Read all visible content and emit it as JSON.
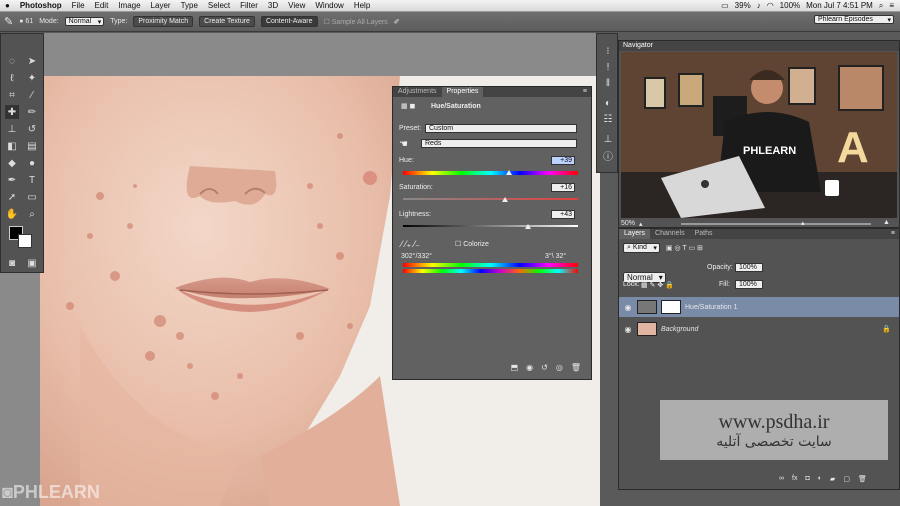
{
  "menubar": {
    "apple": "",
    "app": "Photoshop",
    "items": [
      "File",
      "Edit",
      "Image",
      "Layer",
      "Type",
      "Select",
      "Filter",
      "3D",
      "View",
      "Window",
      "Help"
    ],
    "battery": "39%",
    "battery2": "100%",
    "clock": "Mon Jul 7  4:51 PM"
  },
  "options": {
    "mode_label": "Mode:",
    "mode_value": "Normal",
    "type_label": "Type:",
    "btn_proximity": "Proximity Match",
    "btn_texture": "Create Texture",
    "btn_content": "Content-Aware",
    "sample_all": "Sample All Layers",
    "workspace": "Phlearn Episodes",
    "brush_size": "61"
  },
  "props": {
    "tab_adjust": "Adjustments",
    "tab_props": "Properties",
    "title": "Hue/Saturation",
    "preset_label": "Preset:",
    "preset_value": "Custom",
    "channel_value": "Reds",
    "hue_label": "Hue:",
    "hue_value": "+39",
    "sat_label": "Saturation:",
    "sat_value": "+16",
    "light_label": "Lightness:",
    "light_value": "+43",
    "colorize": "Colorize",
    "range_left": "302°/332°",
    "range_right": "3°\\ 32°",
    "hue": 39,
    "sat": 16,
    "light": 43
  },
  "navigator": {
    "title": "Navigator",
    "zoom": "50%",
    "logo_text": "PHLEARN",
    "letter": "A"
  },
  "layers": {
    "tabs": [
      "Layers",
      "Channels",
      "Paths"
    ],
    "kind": "Kind",
    "blend": "Normal",
    "opacity_label": "Opacity:",
    "opacity": "100%",
    "lock_label": "Lock:",
    "fill_label": "Fill:",
    "fill": "100%",
    "rows": [
      {
        "name": "Hue/Saturation 1"
      },
      {
        "name": "Background"
      }
    ]
  },
  "watermark": {
    "url": "www.psdha.ir",
    "tagline": "سایت تخصصی آتلیه"
  },
  "logo": "PHLEARN"
}
